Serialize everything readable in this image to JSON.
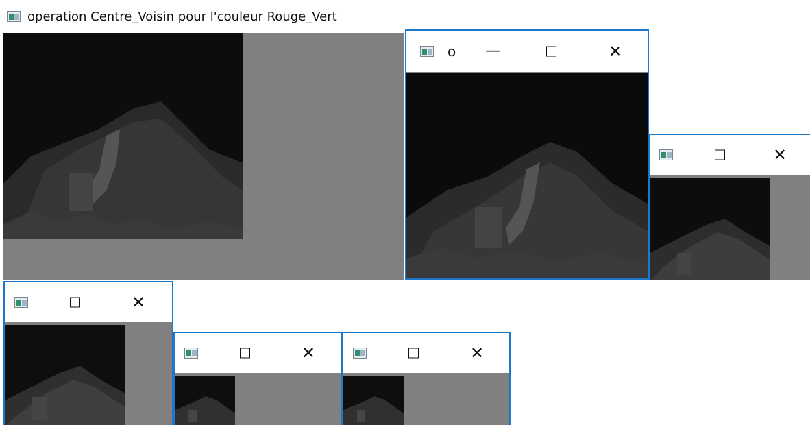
{
  "main_window": {
    "title": "operation Centre_Voisin pour l'couleur Rouge_Vert"
  },
  "window_o": {
    "title": "o",
    "minimize_glyph": "—",
    "close_glyph": "✕"
  },
  "small_windows": [
    {
      "close_glyph": "✕"
    },
    {
      "close_glyph": "✕"
    },
    {
      "close_glyph": "✕"
    },
    {
      "close_glyph": "✕"
    }
  ],
  "icons": {
    "app": "app-window-icon",
    "minimize": "minimize-icon",
    "maximize": "maximize-icon",
    "close": "close-icon"
  },
  "colors": {
    "window_border": "#1e77c8",
    "canvas_gray": "#808080",
    "image_dark": "#0c0c0c"
  }
}
